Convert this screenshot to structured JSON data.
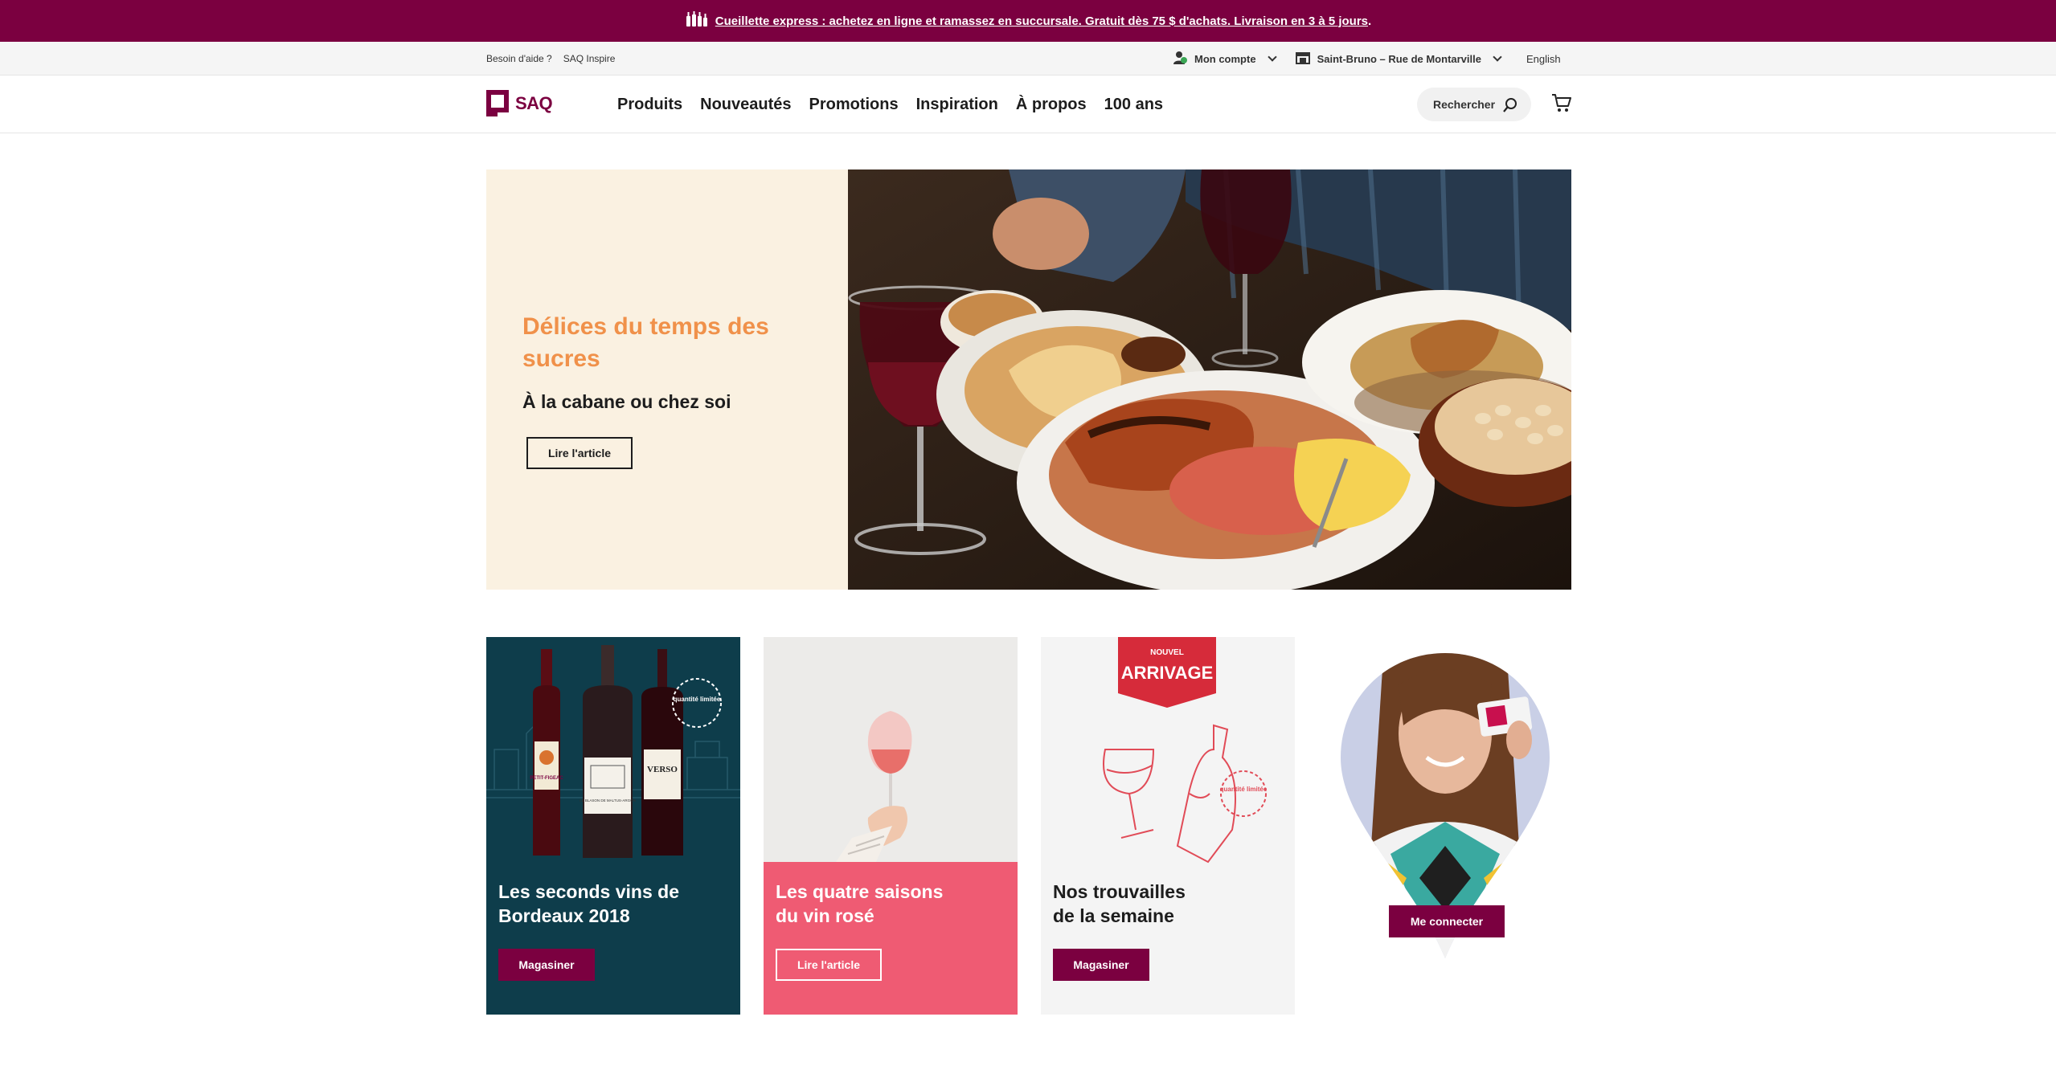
{
  "promo_banner": {
    "text": "Cueillette express : achetez en ligne et ramassez en succursale. Gratuit dès 75 $ d'achats. Livraison en 3 à 5 jours",
    "punctuation": "."
  },
  "utility_bar": {
    "help": "Besoin d'aide ?",
    "inspire": "SAQ Inspire",
    "account": "Mon compte",
    "store": "Saint-Bruno – Rue de Montarville",
    "language": "English"
  },
  "header": {
    "logo_text": "SAQ",
    "nav": [
      "Produits",
      "Nouveautés",
      "Promotions",
      "Inspiration",
      "À propos",
      "100 ans"
    ],
    "search_label": "Rechercher"
  },
  "hero": {
    "title": "Délices du temps des sucres",
    "subtitle": "À la cabane ou chez soi",
    "button": "Lire l'article"
  },
  "cards": [
    {
      "title": "Les seconds vins de Bordeaux 2018",
      "button": "Magasiner",
      "badge": "quantité limitée",
      "bottle_labels": [
        "PETIT-FIGEAC",
        "LE BLASON DE MALTUS-ARGON",
        "VERSO"
      ]
    },
    {
      "title_line1": "Les quatre saisons",
      "title_line2": "du vin rosé",
      "button": "Lire l'article"
    },
    {
      "title_line1": "Nos trouvailles",
      "title_line2": "de la semaine",
      "button": "Magasiner",
      "ribbon_top": "NOUVEL",
      "ribbon_main": "ARRIVAGE",
      "badge": "quantité limitée"
    },
    {
      "button": "Me connecter"
    }
  ],
  "colors": {
    "brand": "#7b0040",
    "hero_title": "#f0914a",
    "card1_bg": "#0e3d4b",
    "card2_bg": "#ef5b73",
    "card3_bg": "#f4f4f4",
    "hero_bg": "#faf1e1"
  }
}
